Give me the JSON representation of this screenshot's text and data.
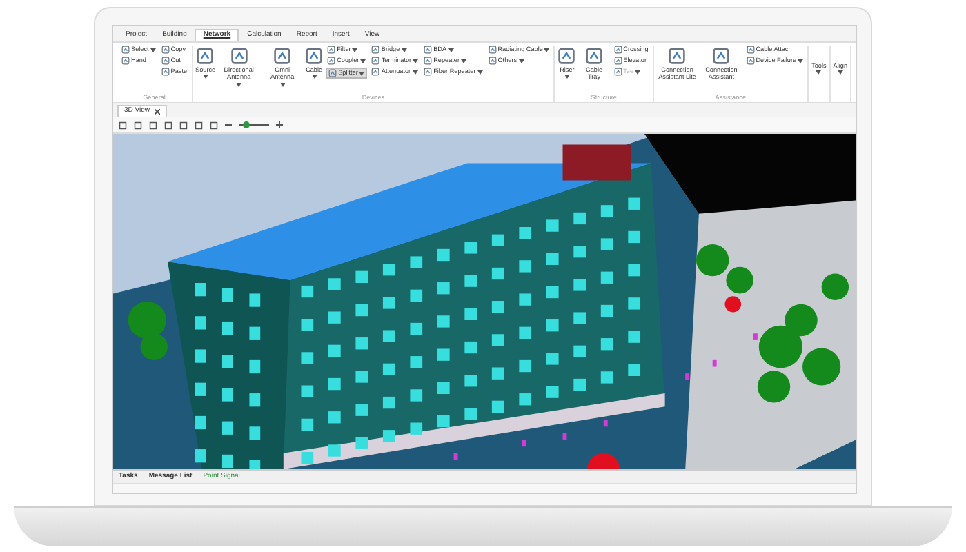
{
  "menu_tabs": [
    {
      "label": "Project",
      "selected": false
    },
    {
      "label": "Building",
      "selected": false
    },
    {
      "label": "Network",
      "selected": true
    },
    {
      "label": "Calculation",
      "selected": false
    },
    {
      "label": "Report",
      "selected": false
    },
    {
      "label": "Insert",
      "selected": false
    },
    {
      "label": "View",
      "selected": false
    }
  ],
  "ribbon_groups": [
    {
      "label": "General",
      "columns": [
        {
          "kind": "stack",
          "items": [
            {
              "label": "Select",
              "dropdown": true,
              "disabled": false,
              "highlighted": false
            },
            {
              "label": "Hand",
              "dropdown": false,
              "disabled": false,
              "highlighted": false
            }
          ]
        },
        {
          "kind": "stack",
          "items": [
            {
              "label": "Copy",
              "dropdown": false,
              "disabled": false,
              "highlighted": false
            },
            {
              "label": "Cut",
              "dropdown": false,
              "disabled": false,
              "highlighted": false
            },
            {
              "label": "Paste",
              "dropdown": false,
              "disabled": false,
              "highlighted": false
            }
          ]
        }
      ]
    },
    {
      "label": "Devices",
      "columns": [
        {
          "kind": "large",
          "label": "Source",
          "dropdown": true
        },
        {
          "kind": "large",
          "label": "Directional Antenna",
          "dropdown": true
        },
        {
          "kind": "large",
          "label": "Omni Antenna",
          "dropdown": true
        },
        {
          "kind": "large",
          "label": "Cable",
          "dropdown": true
        },
        {
          "kind": "stack",
          "items": [
            {
              "label": "Filter",
              "dropdown": true,
              "disabled": false,
              "highlighted": false
            },
            {
              "label": "Coupler",
              "dropdown": true,
              "disabled": false,
              "highlighted": false
            },
            {
              "label": "Splitter",
              "dropdown": true,
              "disabled": false,
              "highlighted": true
            }
          ]
        },
        {
          "kind": "stack",
          "items": [
            {
              "label": "Bridge",
              "dropdown": true,
              "disabled": false,
              "highlighted": false
            },
            {
              "label": "Terminator",
              "dropdown": true,
              "disabled": false,
              "highlighted": false
            },
            {
              "label": "Attenuator",
              "dropdown": true,
              "disabled": false,
              "highlighted": false
            }
          ]
        },
        {
          "kind": "stack",
          "items": [
            {
              "label": "BDA",
              "dropdown": true,
              "disabled": false,
              "highlighted": false
            },
            {
              "label": "Repeater",
              "dropdown": true,
              "disabled": false,
              "highlighted": false
            },
            {
              "label": "Fiber Repeater",
              "dropdown": true,
              "disabled": false,
              "highlighted": false
            }
          ]
        },
        {
          "kind": "stack",
          "items": [
            {
              "label": "Radiating Cable",
              "dropdown": true,
              "disabled": false,
              "highlighted": false
            },
            {
              "label": "Others",
              "dropdown": true,
              "disabled": false,
              "highlighted": false
            }
          ]
        }
      ]
    },
    {
      "label": "Structure",
      "columns": [
        {
          "kind": "large",
          "label": "Riser",
          "dropdown": true
        },
        {
          "kind": "large",
          "label": "Cable Tray",
          "dropdown": false
        },
        {
          "kind": "stack",
          "items": [
            {
              "label": "Crossing",
              "dropdown": false,
              "disabled": false,
              "highlighted": false
            },
            {
              "label": "Elevator",
              "dropdown": false,
              "disabled": false,
              "highlighted": false
            },
            {
              "label": "Tee",
              "dropdown": true,
              "disabled": true,
              "highlighted": false
            }
          ]
        }
      ]
    },
    {
      "label": "Assistance",
      "columns": [
        {
          "kind": "large",
          "label": "Connection Assistant Lite",
          "dropdown": false
        },
        {
          "kind": "large",
          "label": "Connection Assistant",
          "dropdown": false
        },
        {
          "kind": "stack",
          "items": [
            {
              "label": "Cable Attach",
              "dropdown": false,
              "disabled": false,
              "highlighted": false
            },
            {
              "label": "Device Failure",
              "dropdown": true,
              "disabled": false,
              "highlighted": false
            }
          ]
        }
      ]
    },
    {
      "columns": [
        {
          "kind": "menu",
          "label": "Tools",
          "dropdown": true
        }
      ]
    },
    {
      "columns": [
        {
          "kind": "menu",
          "label": "Align",
          "dropdown": true
        }
      ]
    }
  ],
  "document_tab": {
    "label": "3D View"
  },
  "zoom_slider": {
    "level": 0.25
  },
  "panel_tabs": [
    {
      "label": "Tasks",
      "selected": false
    },
    {
      "label": "Message List",
      "selected": false
    },
    {
      "label": "Point Signal",
      "selected": true
    }
  ]
}
